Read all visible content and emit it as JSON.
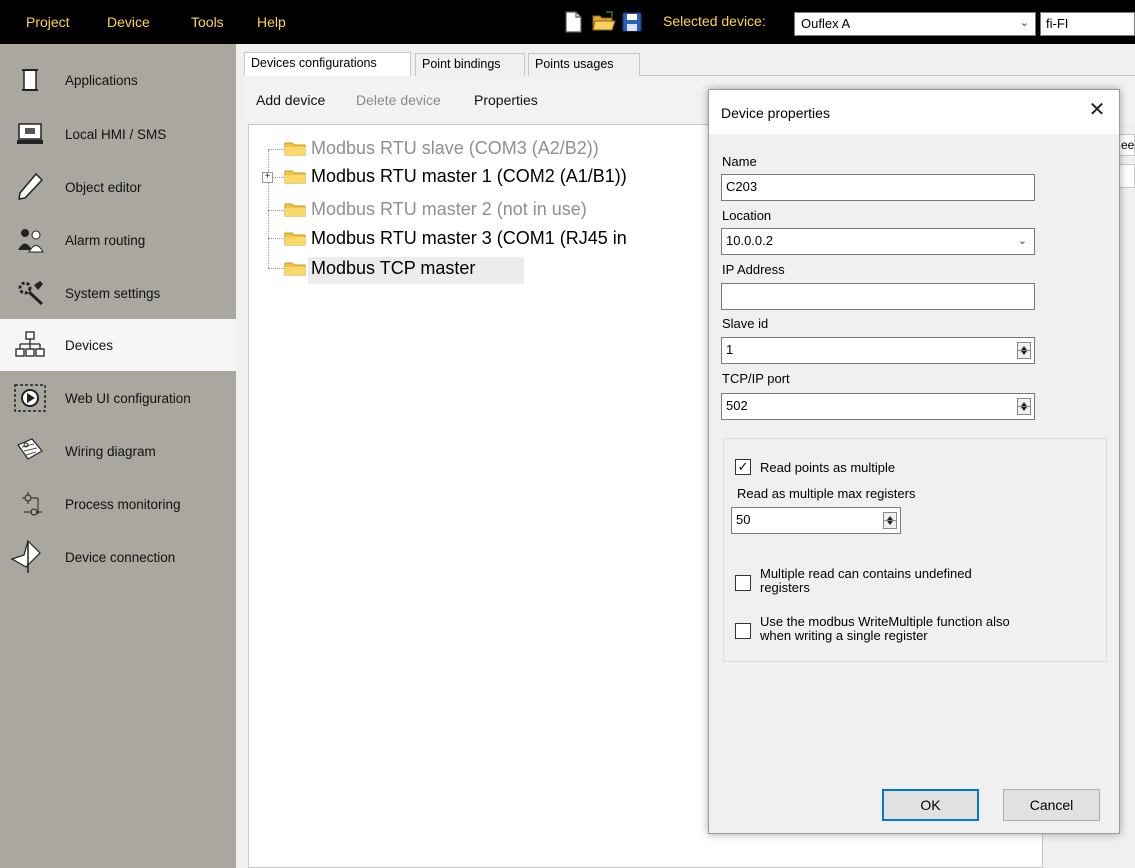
{
  "menubar": {
    "items": [
      "Project",
      "Device",
      "Tools",
      "Help"
    ],
    "selected_device_label": "Selected device:",
    "selected_device_value": "Ouflex A",
    "locale_value": "fi-FI"
  },
  "sidebar": {
    "items": [
      {
        "label": "Applications",
        "icon": "applications-icon",
        "active": false
      },
      {
        "label": "Local HMI / SMS",
        "icon": "local-hmi-icon",
        "active": false
      },
      {
        "label": "Object editor",
        "icon": "pencil-icon",
        "active": false
      },
      {
        "label": "Alarm routing",
        "icon": "alarm-routing-icon",
        "active": false
      },
      {
        "label": "System settings",
        "icon": "system-settings-icon",
        "active": false
      },
      {
        "label": "Devices",
        "icon": "devices-icon",
        "active": true
      },
      {
        "label": "Web UI configuration",
        "icon": "web-ui-icon",
        "active": false
      },
      {
        "label": "Wiring diagram",
        "icon": "wiring-diagram-icon",
        "active": false
      },
      {
        "label": "Process monitoring",
        "icon": "process-monitoring-icon",
        "active": false
      },
      {
        "label": "Device connection",
        "icon": "device-connection-icon",
        "active": false
      }
    ]
  },
  "tabs": [
    "Devices configurations",
    "Point bindings",
    "Points usages"
  ],
  "toolbar": {
    "add_device": "Add device",
    "delete_device": "Delete device",
    "properties": "Properties"
  },
  "tree": [
    {
      "label": "Modbus RTU slave (COM3 (A2/B2))",
      "disabled": true
    },
    {
      "label": "Modbus RTU master 1 (COM2 (A1/B1))",
      "disabled": false
    },
    {
      "label": "Modbus RTU master 2 (not in use)",
      "disabled": true
    },
    {
      "label": "Modbus RTU master 3 (COM1 (RJ45 in",
      "disabled": false
    },
    {
      "label": "Modbus TCP master",
      "disabled": false
    }
  ],
  "right_strip": {
    "partial_label": "ee"
  },
  "dialog": {
    "title": "Device properties",
    "name_label": "Name",
    "name_value": "C203",
    "location_label": "Location",
    "location_value": "10.0.0.2",
    "ip_label": "IP Address",
    "ip_value": "",
    "slave_id_label": "Slave id",
    "slave_id_value": "1",
    "port_label": "TCP/IP port",
    "port_value": "502",
    "read_multiple_label": "Read points as multiple",
    "read_multiple_checked": true,
    "max_registers_label": "Read as multiple max registers",
    "max_registers_value": "50",
    "undefined_label_1": "Multiple read can contains undefined",
    "undefined_label_2": "registers",
    "undefined_checked": false,
    "write_multiple_label_1": "Use the modbus WriteMultiple function also",
    "write_multiple_label_2": "when writing a single register",
    "write_multiple_checked": false,
    "ok_label": "OK",
    "cancel_label": "Cancel"
  },
  "colors": {
    "menu_text": "#ffd54a",
    "sidebar_bg": "#a9a79f",
    "folder": "#f5c342",
    "ok_border": "#0078d7"
  }
}
